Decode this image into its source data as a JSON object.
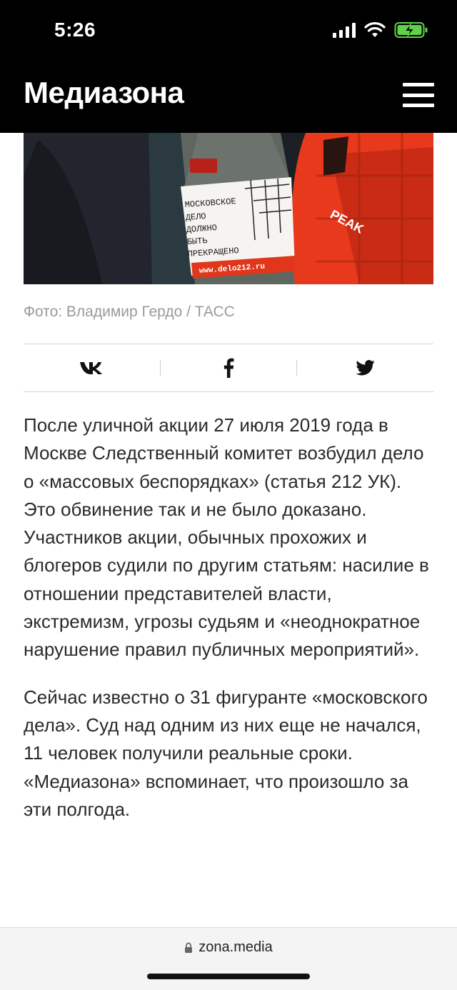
{
  "status_bar": {
    "time": "5:26",
    "icons": [
      "signal-icon",
      "wifi-icon",
      "battery-charging-icon"
    ]
  },
  "header": {
    "logo": "Медиазона",
    "menu_icon": "hamburger-menu-icon"
  },
  "photo": {
    "sign_lines": [
      "МОСКОВСКОЕ",
      "ДЕЛО",
      "ДОЛЖНО",
      "БЫТЬ",
      "ПРЕКРАЩЕНО"
    ],
    "sign_url": "www.delo212.ru",
    "caption": "Фото: Владимир Гердо / ТАСС"
  },
  "share": {
    "buttons": [
      "vk-icon",
      "facebook-icon",
      "twitter-icon"
    ]
  },
  "article": {
    "paragraphs": [
      "После уличной акции 27 июля 2019 года в Москве Следственный комитет возбудил дело о «массовых беспорядках» (статья 212 УК). Это обвинение так и не было доказано. Участников акции, обычных прохожих и блогеров судили по другим статьям: насилие в отношении представителей власти, экстремизм, угрозы судьям и «неоднократное нарушение правил публичных мероприятий».",
      "Сейчас известно о 31 фигуранте «московского дела». Суд над одним из них еще не начался, 11 человек получили реальные сроки. «Медиазона» вспоминает, что произошло за эти полгода."
    ]
  },
  "browser": {
    "url": "zona.media",
    "lock_icon": "lock-icon"
  },
  "colors": {
    "header_bg": "#000000",
    "accent_red": "#e8391d",
    "caption_gray": "#9a9a9a"
  }
}
